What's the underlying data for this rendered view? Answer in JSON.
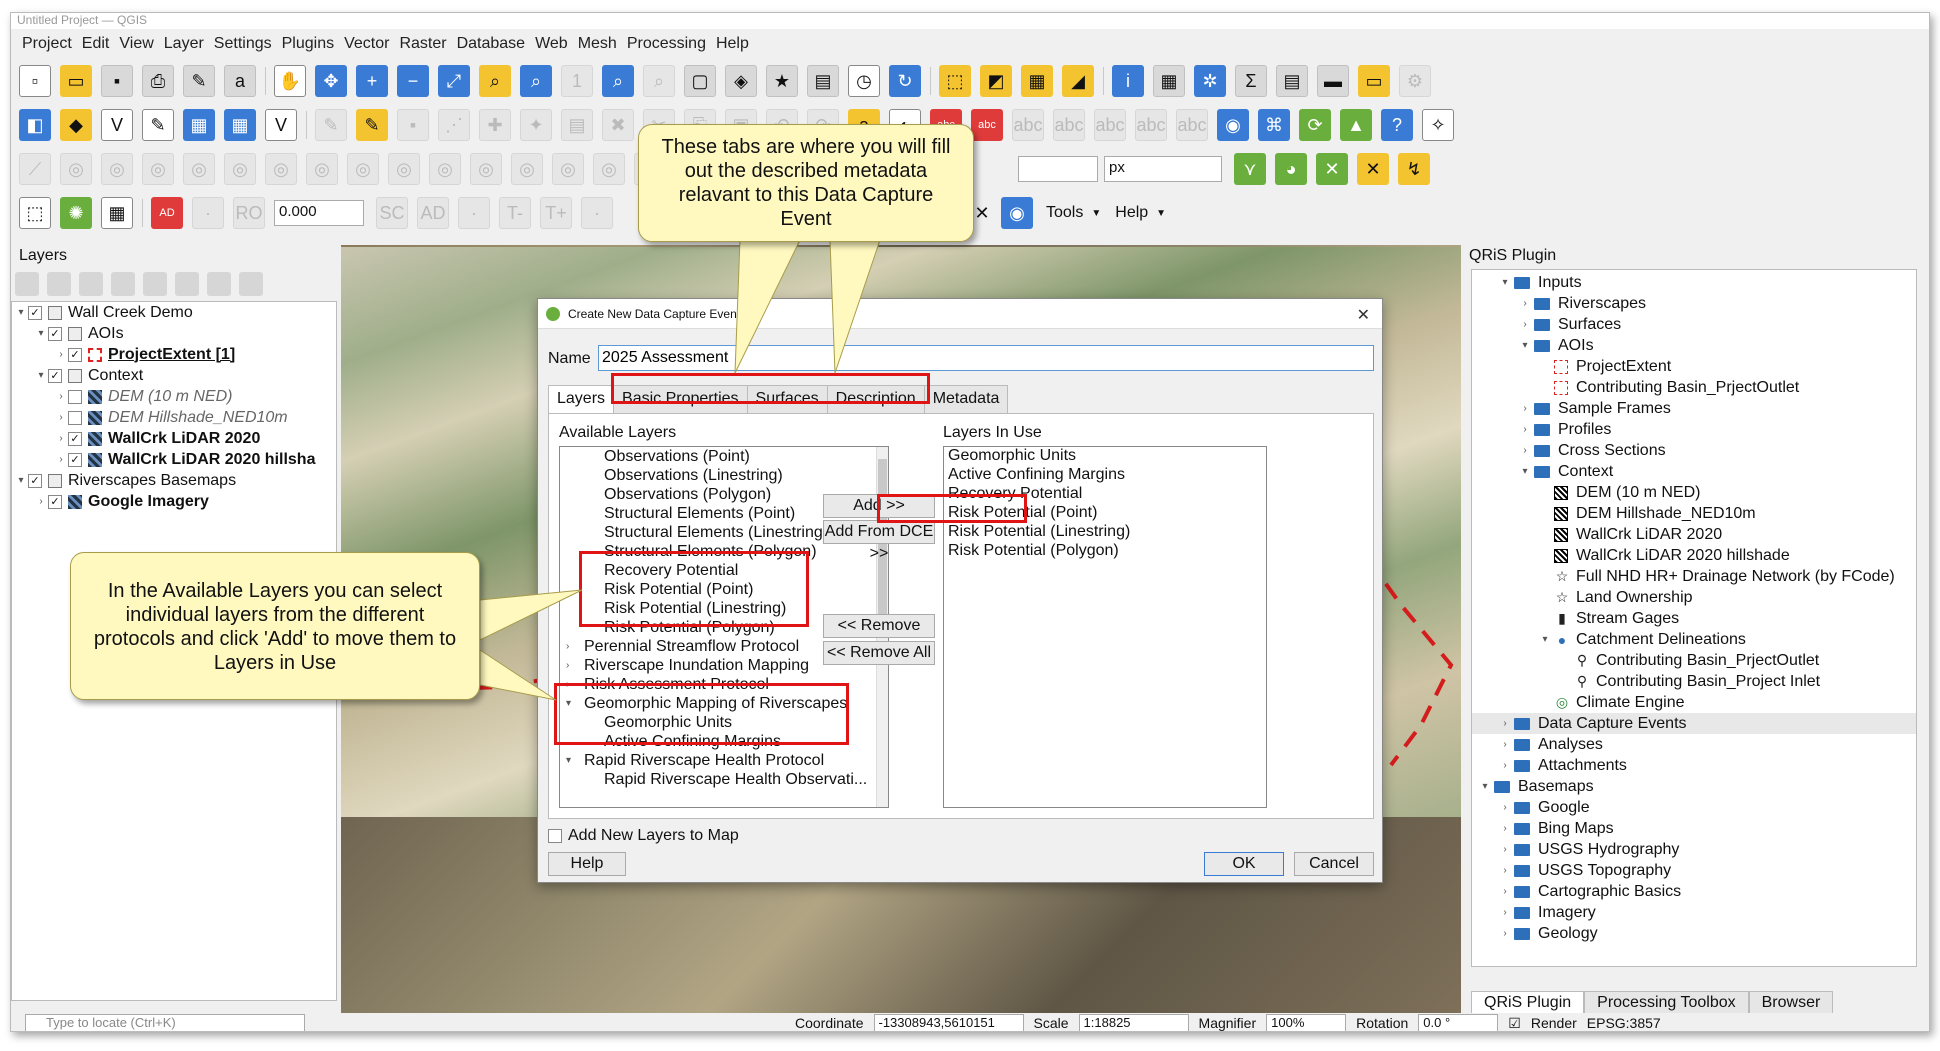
{
  "window": {
    "title": "Untitled Project — QGIS"
  },
  "menu": [
    "Project",
    "Edit",
    "View",
    "Layer",
    "Settings",
    "Plugins",
    "Vector",
    "Raster",
    "Database",
    "Web",
    "Mesh",
    "Processing",
    "Help"
  ],
  "toolbar": {
    "rotation_value": "0.000",
    "units_value": "px",
    "tools_label": "Tools",
    "help_label": "Help"
  },
  "layers_panel": {
    "title": "Layers",
    "items": [
      {
        "label": "Wall Creek Demo",
        "indent": 0,
        "checked": true,
        "expanded": true,
        "kind": "group",
        "style": ""
      },
      {
        "label": "AOIs",
        "indent": 1,
        "checked": true,
        "expanded": true,
        "kind": "group",
        "style": ""
      },
      {
        "label": "ProjectExtent [1]",
        "indent": 2,
        "checked": true,
        "expanded": false,
        "kind": "vector",
        "style": "bold"
      },
      {
        "label": "Context",
        "indent": 1,
        "checked": true,
        "expanded": true,
        "kind": "group",
        "style": ""
      },
      {
        "label": "DEM (10 m NED)",
        "indent": 2,
        "checked": false,
        "expanded": false,
        "kind": "raster",
        "style": "italic"
      },
      {
        "label": "DEM Hillshade_NED10m",
        "indent": 2,
        "checked": false,
        "expanded": false,
        "kind": "raster",
        "style": "italic"
      },
      {
        "label": "WallCrk LiDAR 2020",
        "indent": 2,
        "checked": true,
        "expanded": false,
        "kind": "raster",
        "style": "bold"
      },
      {
        "label": "WallCrk LiDAR 2020 hillsha",
        "indent": 2,
        "checked": true,
        "expanded": false,
        "kind": "raster",
        "style": "bold"
      },
      {
        "label": "Riverscapes Basemaps",
        "indent": 0,
        "checked": true,
        "expanded": true,
        "kind": "group",
        "style": ""
      },
      {
        "label": "Google Imagery",
        "indent": 1,
        "checked": true,
        "expanded": false,
        "kind": "raster",
        "style": "bold"
      }
    ]
  },
  "status_bar": {
    "locator_placeholder": "Type to locate (Ctrl+K)",
    "coordinate_label": "Coordinate",
    "coordinate_value": "-13308943,5610151",
    "scale_label": "Scale",
    "scale_value": "1:18825",
    "magnifier_label": "Magnifier",
    "magnifier_value": "100%",
    "rotation_label": "Rotation",
    "rotation_value": "0.0 °",
    "render_label": "Render",
    "crs": "EPSG:3857"
  },
  "qris_panel": {
    "title": "QRiS Plugin",
    "items": [
      {
        "label": "Inputs",
        "indent": 1,
        "expanded": true,
        "icon": "folder"
      },
      {
        "label": "Riverscapes",
        "indent": 2,
        "expanded": false,
        "icon": "folder"
      },
      {
        "label": "Surfaces",
        "indent": 2,
        "expanded": false,
        "icon": "folder"
      },
      {
        "label": "AOIs",
        "indent": 2,
        "expanded": true,
        "icon": "folder"
      },
      {
        "label": "ProjectExtent",
        "indent": 3,
        "expanded": null,
        "icon": "polygon"
      },
      {
        "label": "Contributing Basin_PrjectOutlet",
        "indent": 3,
        "expanded": null,
        "icon": "polygon"
      },
      {
        "label": "Sample Frames",
        "indent": 2,
        "expanded": false,
        "icon": "folder"
      },
      {
        "label": "Profiles",
        "indent": 2,
        "expanded": false,
        "icon": "folder"
      },
      {
        "label": "Cross Sections",
        "indent": 2,
        "expanded": false,
        "icon": "folder"
      },
      {
        "label": "Context",
        "indent": 2,
        "expanded": true,
        "icon": "folder"
      },
      {
        "label": "DEM (10 m NED)",
        "indent": 3,
        "expanded": null,
        "icon": "raster"
      },
      {
        "label": "DEM Hillshade_NED10m",
        "indent": 3,
        "expanded": null,
        "icon": "raster"
      },
      {
        "label": "WallCrk LiDAR 2020",
        "indent": 3,
        "expanded": null,
        "icon": "raster"
      },
      {
        "label": "WallCrk LiDAR 2020 hillshade",
        "indent": 3,
        "expanded": null,
        "icon": "raster"
      },
      {
        "label": "Full NHD HR+ Drainage Network (by FCode)",
        "indent": 3,
        "expanded": null,
        "icon": "star"
      },
      {
        "label": "Land Ownership",
        "indent": 3,
        "expanded": null,
        "icon": "star"
      },
      {
        "label": "Stream Gages",
        "indent": 3,
        "expanded": null,
        "icon": "gage"
      },
      {
        "label": "Catchment Delineations",
        "indent": 3,
        "expanded": true,
        "icon": "catchment"
      },
      {
        "label": "Contributing Basin_PrjectOutlet",
        "indent": 4,
        "expanded": null,
        "icon": "pin"
      },
      {
        "label": "Contributing Basin_Project Inlet",
        "indent": 4,
        "expanded": null,
        "icon": "pin"
      },
      {
        "label": "Climate Engine",
        "indent": 3,
        "expanded": null,
        "icon": "climate"
      },
      {
        "label": "Data Capture Events",
        "indent": 1,
        "expanded": false,
        "icon": "folder",
        "selected": true
      },
      {
        "label": "Analyses",
        "indent": 1,
        "expanded": false,
        "icon": "folder"
      },
      {
        "label": "Attachments",
        "indent": 1,
        "expanded": false,
        "icon": "folder"
      },
      {
        "label": "Basemaps",
        "indent": 0,
        "expanded": true,
        "icon": "folder"
      },
      {
        "label": "Google",
        "indent": 1,
        "expanded": false,
        "icon": "folder"
      },
      {
        "label": "Bing Maps",
        "indent": 1,
        "expanded": false,
        "icon": "folder"
      },
      {
        "label": "USGS Hydrography",
        "indent": 1,
        "expanded": false,
        "icon": "folder"
      },
      {
        "label": "USGS Topography",
        "indent": 1,
        "expanded": false,
        "icon": "folder"
      },
      {
        "label": "Cartographic Basics",
        "indent": 1,
        "expanded": false,
        "icon": "folder"
      },
      {
        "label": "Imagery",
        "indent": 1,
        "expanded": false,
        "icon": "folder"
      },
      {
        "label": "Geology",
        "indent": 1,
        "expanded": false,
        "icon": "folder"
      }
    ],
    "tabs": [
      "QRiS Plugin",
      "Processing Toolbox",
      "Browser"
    ]
  },
  "dialog": {
    "title": "Create New Data Capture Event",
    "name_label": "Name",
    "name_value": "2025 Assessment",
    "tabs": [
      "Layers",
      "Basic Properties",
      "Surfaces",
      "Description",
      "Metadata"
    ],
    "available_label": "Available Layers",
    "available_layers": [
      {
        "label": "Observations (Point)",
        "type": "child"
      },
      {
        "label": "Observations (Linestring)",
        "type": "child"
      },
      {
        "label": "Observations (Polygon)",
        "type": "child"
      },
      {
        "label": "Structural Elements (Point)",
        "type": "child"
      },
      {
        "label": "Structural Elements (Linestring)",
        "type": "child"
      },
      {
        "label": "Structural Elements (Polygon)",
        "type": "child"
      },
      {
        "label": "Recovery Potential",
        "type": "child"
      },
      {
        "label": "Risk Potential (Point)",
        "type": "child"
      },
      {
        "label": "Risk Potential (Linestring)",
        "type": "child"
      },
      {
        "label": "Risk Potential (Polygon)",
        "type": "child"
      },
      {
        "label": "Perennial Streamflow Protocol",
        "type": "parent",
        "expanded": false
      },
      {
        "label": "Riverscape Inundation Mapping",
        "type": "parent",
        "expanded": false
      },
      {
        "label": "Risk Assessment Protocol",
        "type": "parent",
        "expanded": false
      },
      {
        "label": "Geomorphic Mapping of Riverscapes",
        "type": "parent",
        "expanded": true
      },
      {
        "label": "Geomorphic Units",
        "type": "child"
      },
      {
        "label": "Active Confining Margins",
        "type": "child"
      },
      {
        "label": "Rapid Riverscape Health Protocol",
        "type": "parent",
        "expanded": true
      },
      {
        "label": "Rapid Riverscape Health Observati...",
        "type": "child"
      }
    ],
    "used_label": "Layers In Use",
    "layers_in_use": [
      "Geomorphic Units",
      "Active Confining Margins",
      "Recovery Potential",
      "Risk Potential (Point)",
      "Risk Potential (Linestring)",
      "Risk Potential (Polygon)"
    ],
    "add_button": "Add >>",
    "add_from_dce_button": "Add From DCE >>",
    "remove_button": "<< Remove",
    "remove_all_button": "<< Remove All",
    "add_to_map_label": "Add New Layers to Map",
    "help_button": "Help",
    "ok_button": "OK",
    "cancel_button": "Cancel"
  },
  "callouts": {
    "tabs_note": "These tabs are where you will fill out the described metadata relavant to this Data Capture Event",
    "layers_note": "In the Available Layers you can select individual layers from the different protocols and click 'Add' to move them to Layers in Use"
  },
  "colors": {
    "highlight": "#e01414",
    "callout_bg": "#fff9c0",
    "selection": "#5c9ad6"
  }
}
